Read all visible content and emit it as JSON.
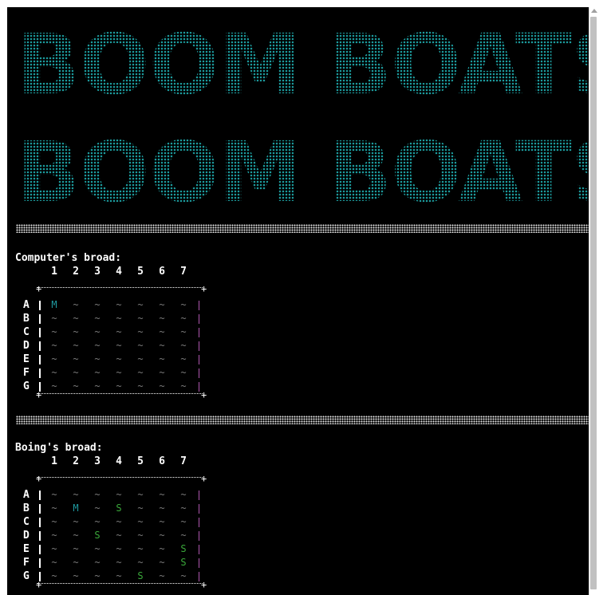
{
  "banner": {
    "line1": "BOOM BOATS",
    "line2": "BOOM BOATS",
    "color": "#1c9a9c"
  },
  "colors": {
    "background": "#000000",
    "water": "#7a7a7a",
    "miss": "#1f9aa0",
    "ship": "#3aa83a",
    "right_border": "#b058b0"
  },
  "symbols": {
    "water": "~",
    "miss": "M",
    "ship": "S",
    "corner": "+"
  },
  "columns": [
    "1",
    "2",
    "3",
    "4",
    "5",
    "6",
    "7"
  ],
  "rows": [
    "A",
    "B",
    "C",
    "D",
    "E",
    "F",
    "G"
  ],
  "computer_board": {
    "title": "Computer's broad:",
    "grid": [
      [
        "M",
        "~",
        "~",
        "~",
        "~",
        "~",
        "~"
      ],
      [
        "~",
        "~",
        "~",
        "~",
        "~",
        "~",
        "~"
      ],
      [
        "~",
        "~",
        "~",
        "~",
        "~",
        "~",
        "~"
      ],
      [
        "~",
        "~",
        "~",
        "~",
        "~",
        "~",
        "~"
      ],
      [
        "~",
        "~",
        "~",
        "~",
        "~",
        "~",
        "~"
      ],
      [
        "~",
        "~",
        "~",
        "~",
        "~",
        "~",
        "~"
      ],
      [
        "~",
        "~",
        "~",
        "~",
        "~",
        "~",
        "~"
      ]
    ]
  },
  "player_board": {
    "title": "Boing's broad:",
    "grid": [
      [
        "~",
        "~",
        "~",
        "~",
        "~",
        "~",
        "~"
      ],
      [
        "~",
        "M",
        "~",
        "S",
        "~",
        "~",
        "~"
      ],
      [
        "~",
        "~",
        "~",
        "~",
        "~",
        "~",
        "~"
      ],
      [
        "~",
        "~",
        "S",
        "~",
        "~",
        "~",
        "~"
      ],
      [
        "~",
        "~",
        "~",
        "~",
        "~",
        "~",
        "S"
      ],
      [
        "~",
        "~",
        "~",
        "~",
        "~",
        "~",
        "S"
      ],
      [
        "~",
        "~",
        "~",
        "~",
        "S",
        "~",
        "~"
      ]
    ]
  }
}
